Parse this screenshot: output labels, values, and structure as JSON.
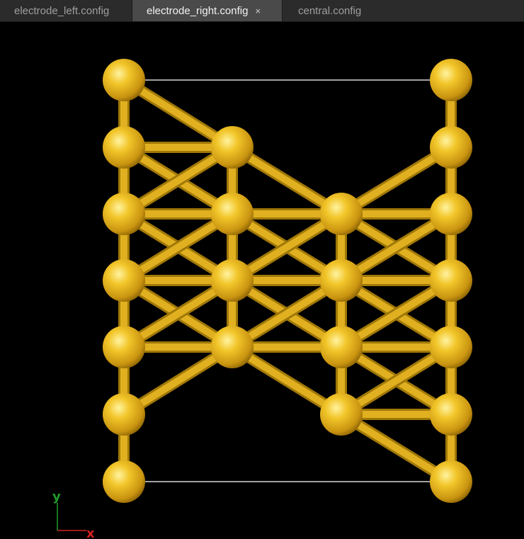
{
  "tabs": [
    {
      "label": "electrode_left.config",
      "active": false
    },
    {
      "label": "electrode_right.config",
      "active": true,
      "close": "×"
    },
    {
      "label": "central.config",
      "active": false
    }
  ],
  "viewer": {
    "background": "#000000",
    "atom_color": "#e8b81c",
    "bond_color": "#e0b020",
    "cell_color": "#ffffff",
    "axes": {
      "x": {
        "label": "x",
        "color": "#d62020"
      },
      "y": {
        "label": "y",
        "color": "#1f9a2a"
      }
    }
  }
}
